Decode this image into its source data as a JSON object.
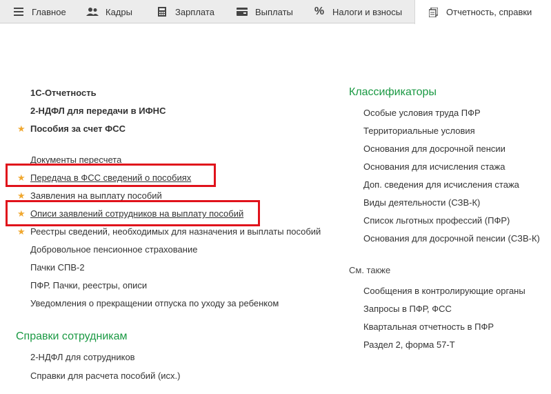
{
  "tabs": [
    {
      "label": "Главное",
      "icon": "hamburger-menu-icon"
    },
    {
      "label": "Кадры",
      "icon": "people-icon"
    },
    {
      "label": "Зарплата",
      "icon": "calculator-icon"
    },
    {
      "label": "Выплаты",
      "icon": "wallet-icon"
    },
    {
      "label": "Налоги и взносы",
      "icon": "percent-icon"
    },
    {
      "label": "Отчетность, справки",
      "icon": "document-icon",
      "active": true
    }
  ],
  "left": {
    "top_items": [
      "1С-Отчетность",
      "2-НДФЛ для передачи в ИФНС",
      "Пособия за счет ФСС"
    ],
    "items": [
      "Документы пересчета",
      "Передача в ФСС сведений о пособиях",
      "Заявления на выплату пособий",
      "Описи заявлений сотрудников на выплату пособий",
      "Реестры сведений, необходимых для назначения и выплаты пособий",
      "Добровольное пенсионное страхование",
      "Пачки СПВ-2",
      "ПФР. Пачки, реестры, описи",
      "Уведомления о прекращении отпуска по уходу за ребенком"
    ],
    "section_title": "Справки сотрудникам",
    "section_items": [
      "2-НДФЛ для сотрудников",
      "Справки для расчета пособий (исх.)"
    ]
  },
  "right": {
    "section_title": "Классификаторы",
    "items": [
      "Особые условия труда ПФР",
      "Территориальные условия",
      "Основания для досрочной пенсии",
      "Основания для исчисления стажа",
      "Доп. сведения для исчисления стажа",
      "Виды деятельности (СЗВ-К)",
      "Список льготных профессий (ПФР)",
      "Основания для досрочной пенсии (СЗВ-К)"
    ],
    "see_also_title": "См. также",
    "see_also_items": [
      "Сообщения в контролирующие органы",
      "Запросы в ПФР, ФСС",
      "Квартальная отчетность в ПФР",
      "Раздел 2, форма 57-Т"
    ]
  },
  "colors": {
    "accent_green": "#1a9943",
    "highlight_red": "#e0121b",
    "star": "#f0a830",
    "tab_bar": "#ececec"
  }
}
